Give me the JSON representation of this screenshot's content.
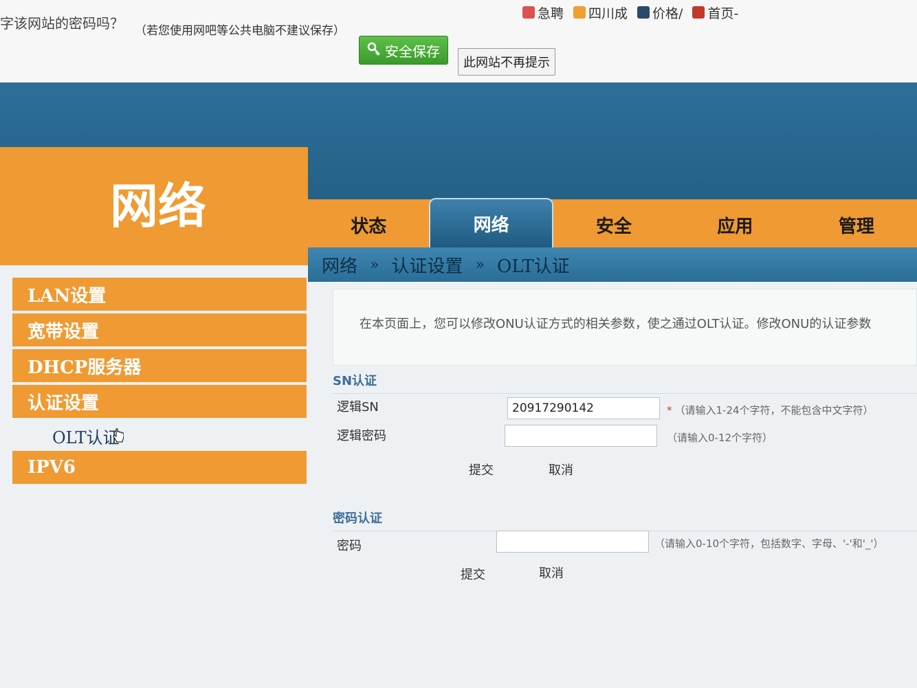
{
  "password_bar": {
    "question": "字该网站的密码吗？",
    "warning": "（若您使用网吧等公共电脑不建议保存）",
    "save_label": "安全保存",
    "dismiss_label": "此网站不再提示"
  },
  "bookmarks": [
    {
      "label": "急聘",
      "color": "#d9534f"
    },
    {
      "label": "四川成",
      "color": "#f0a030"
    },
    {
      "label": "价格/",
      "color": "#2b4a6b"
    },
    {
      "label": "首页-",
      "color": "#c0392b"
    }
  ],
  "header": {
    "brand_title": "网络"
  },
  "tabs": [
    {
      "label": "状态"
    },
    {
      "label": "网络"
    },
    {
      "label": "安全"
    },
    {
      "label": "应用"
    },
    {
      "label": "管理"
    }
  ],
  "breadcrumb": {
    "part1": "网络",
    "part2": "认证设置",
    "part3": "OLT认证",
    "separator": "»"
  },
  "sidebar": {
    "items": [
      {
        "label": "LAN设置"
      },
      {
        "label": "宽带设置"
      },
      {
        "label": "DHCP服务器"
      },
      {
        "label": "认证设置"
      },
      {
        "label": "OLT认证"
      },
      {
        "label": "IPV6"
      }
    ]
  },
  "content": {
    "intro": "在本页面上，您可以修改ONU认证方式的相关参数，使之通过OLT认证。修改ONU的认证参数",
    "sn_section": {
      "title": "SN认证",
      "sn_label": "逻辑SN",
      "sn_value": "20917290142",
      "sn_hint": "（请输入1-24个字符，不能包含中文字符）",
      "pwd_label": "逻辑密码",
      "pwd_value": "",
      "pwd_hint": "（请输入0-12个字符）",
      "submit": "提交",
      "cancel": "取消"
    },
    "pwd_section": {
      "title": "密码认证",
      "pwd_label": "密码",
      "pwd_value": "",
      "pwd_hint": "（请输入0-10个字符，包括数字、字母、'-'和'_'）",
      "submit": "提交",
      "cancel": "取消"
    }
  },
  "colors": {
    "orange": "#ef9a32",
    "blue": "#1f5a80",
    "accent_green": "#3a9b2c"
  }
}
